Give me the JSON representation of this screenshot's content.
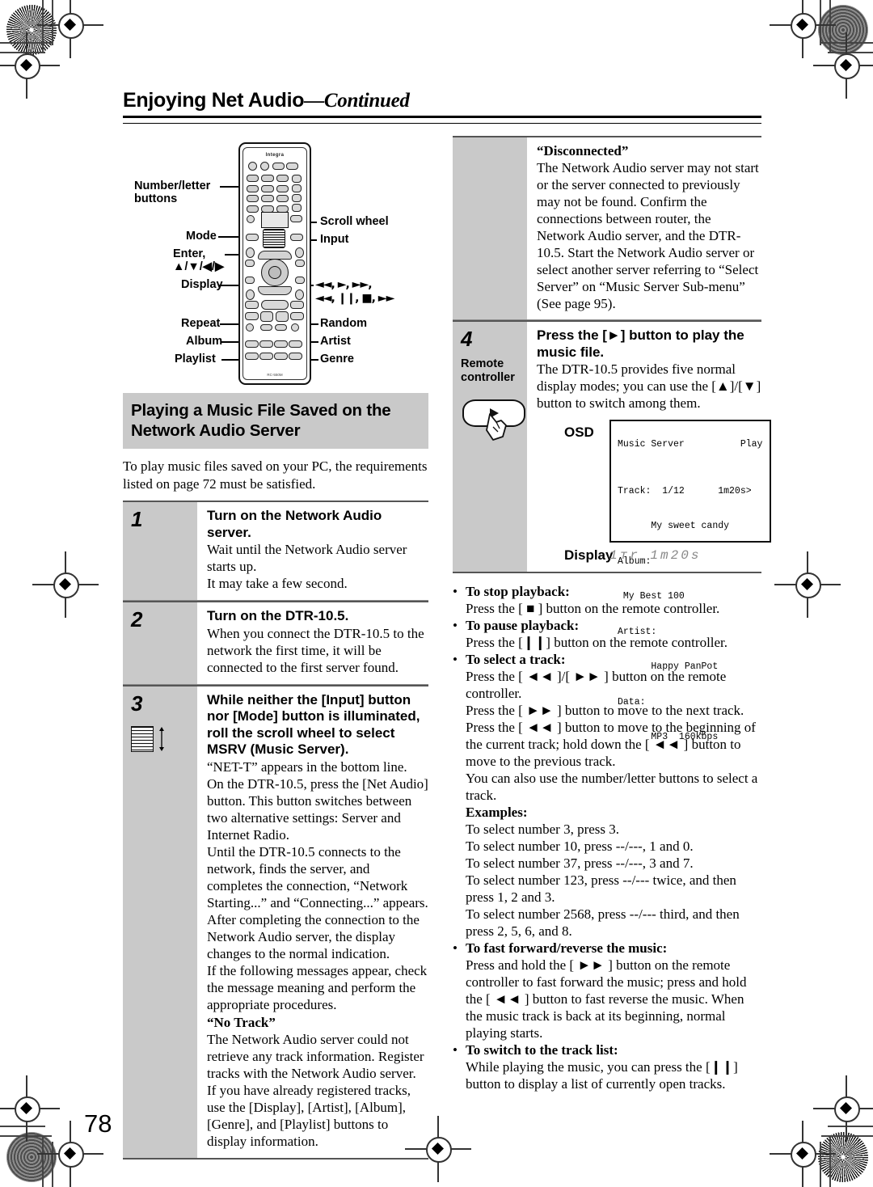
{
  "header": {
    "title_main": "Enjoying Net Audio",
    "title_dash": "—",
    "title_cont": "Continued"
  },
  "page_number": "78",
  "remote_figure": {
    "brand": "Integra",
    "model": "RC-550M",
    "labels": {
      "number_letter": "Number/letter\nbuttons",
      "mode": "Mode",
      "enter": "Enter,\n▲/▼/◀/▶",
      "display": "Display",
      "repeat": "Repeat",
      "album": "Album",
      "playlist": "Playlist",
      "scroll_wheel": "Scroll wheel",
      "input": "Input",
      "random": "Random",
      "artist": "Artist",
      "genre": "Genre",
      "transport_line1": "◄◄, ►, ►►,",
      "transport_line2": "◄◄, ❙❙, ■, ►►"
    }
  },
  "section": {
    "heading": "Playing a Music File Saved on the Network Audio Server",
    "intro": "To play music files saved on your PC, the requirements listed on page 72 must be satisfied."
  },
  "steps": [
    {
      "number": "1",
      "sub": "",
      "head": "Turn on the Network Audio server.",
      "paras": [
        "Wait until the Network Audio server starts up.",
        "It may take a few second."
      ]
    },
    {
      "number": "2",
      "sub": "",
      "head": "Turn on the DTR-10.5.",
      "paras": [
        "When you connect the DTR-10.5 to the network the first time, it will be connected to the first server found."
      ]
    },
    {
      "number": "3",
      "sub": "",
      "head": "While neither the [Input] button nor [Mode] button is illuminated, roll the scroll wheel to select MSRV (Music Server).",
      "paras": [
        "“NET-T” appears in the bottom line.",
        "On the DTR-10.5, press the [Net Audio] button. This button switches between two alternative settings: Server and Internet Radio.",
        "Until the DTR-10.5 connects to the network, finds the server, and completes the connection, “Network Starting...” and “Connecting...” appears. After completing the connection to the Network Audio server, the display changes to the normal indication.",
        "If the following messages appear, check the message meaning and perform the appropriate procedures."
      ],
      "message": {
        "title": "“No Track”",
        "body": "The Network Audio server could not retrieve any track information. Register tracks with the Network Audio server.\nIf you have already registered tracks, use the [Display], [Artist], [Album], [Genre], and [Playlist] buttons to display information."
      }
    }
  ],
  "disconnected": {
    "title": "“Disconnected”",
    "body": "The Network Audio server may not start or the server connected to previously may not be found. Confirm the connections between router, the Network Audio server, and the DTR-10.5. Start the Network Audio server or select another server referring to “Select Server” on “Music Server Sub-menu” (See page 95)."
  },
  "step4": {
    "number": "4",
    "sub": "Remote\ncontroller",
    "head": "Press the [►] button to play the music file.",
    "para": "The DTR-10.5 provides five normal display modes; you can use the [▲]/[▼] button to switch among them.",
    "osd_label": "OSD",
    "osd_lines": [
      "Music Server          Play",
      "",
      "Track:  1/12      1m20s>",
      "      My sweet candy",
      "Album:",
      " My Best 100",
      "Artist:",
      "      Happy PanPot",
      "Data:",
      "      MP3  160kbps"
    ],
    "display_label": "Display",
    "display_value": "1тr    1m20s"
  },
  "bullets": [
    {
      "title": "To stop playback:",
      "lines": [
        "Press the [ ■ ] button on the remote controller."
      ]
    },
    {
      "title": "To pause playback:",
      "lines": [
        "Press the [❙❙] button on the remote controller."
      ]
    },
    {
      "title": "To select a track:",
      "lines": [
        "Press the [ ◄◄ ]/[ ►► ] button on the remote controller.",
        "Press the [ ►► ] button to move to the next track.",
        "Press the [ ◄◄ ] button to move to the beginning of the current track; hold down the [ ◄◄ ] button to move to the previous track.",
        "You can also use the number/letter buttons to select a track."
      ],
      "examples_title": "Examples:",
      "examples": [
        "To select number 3, press 3.",
        "To select number 10, press --/---, 1 and 0.",
        "To select number 37, press --/---, 3 and 7.",
        "To select number 123, press --/--- twice, and then press 1, 2 and 3.",
        "To select number 2568, press --/--- third, and then press 2, 5, 6, and 8."
      ]
    },
    {
      "title": "To fast forward/reverse the music:",
      "lines": [
        "Press and hold the [ ►► ] button on the remote controller to fast forward the music; press and hold the [ ◄◄ ] button to fast reverse the music. When the music track is back at its beginning, normal playing starts."
      ]
    },
    {
      "title": "To switch to the track list:",
      "lines": [
        "While playing the music, you can press the [❙❙] button to display a list of currently open tracks."
      ]
    }
  ]
}
